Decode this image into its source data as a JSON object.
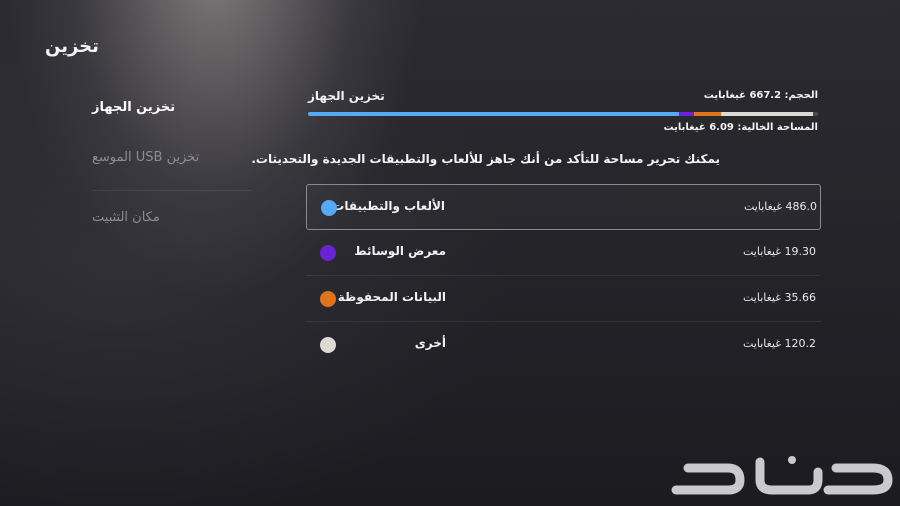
{
  "page_title": "تخزين",
  "menu": [
    {
      "label": "تخزين الجهاز"
    },
    {
      "label": "تخزين USB الموسع"
    },
    {
      "label": "مكان التثبيت"
    }
  ],
  "storage": {
    "title": "تخزين الجهاز",
    "capacity_text": "الحجم: 667.2 غيغابايت",
    "free_text": "المساحة الخالية: 6.09 غيغابايت",
    "info_text": "يمكنك تحرير مساحة للتأكد من أنك جاهز للألعاب والتطبيقات الجديدة والتحديثات.",
    "usage_bar": {
      "total_gb": 667.2,
      "segments": [
        {
          "name": "الألعاب والتطبيقات",
          "gb": 486.0,
          "color": "#55a9f5"
        },
        {
          "name": "معرض الوسائط",
          "gb": 19.3,
          "color": "#6a23d6"
        },
        {
          "name": "البيانات المحفوظة",
          "gb": 35.66,
          "color": "#e1741a"
        },
        {
          "name": "أخرى",
          "gb": 120.2,
          "color": "#dcdad5"
        }
      ]
    },
    "categories": [
      {
        "label": "الألعاب والتطبيقات",
        "size": "486.0 غيغابايت",
        "color": "#55a9f5",
        "icon": "games-color-dot-icon"
      },
      {
        "label": "معرض الوسائط",
        "size": "19.30 غيغابايت",
        "color": "#6a23d6",
        "icon": "media-color-dot-icon"
      },
      {
        "label": "البيانات المحفوظة",
        "size": "35.66 غيغابايت",
        "color": "#e1741a",
        "icon": "saved-data-color-dot-icon"
      },
      {
        "label": "أخرى",
        "size": "120.2 غيغابايت",
        "color": "#dcdad5",
        "icon": "other-color-dot-icon"
      }
    ]
  },
  "watermark": {
    "text": "حراج"
  }
}
